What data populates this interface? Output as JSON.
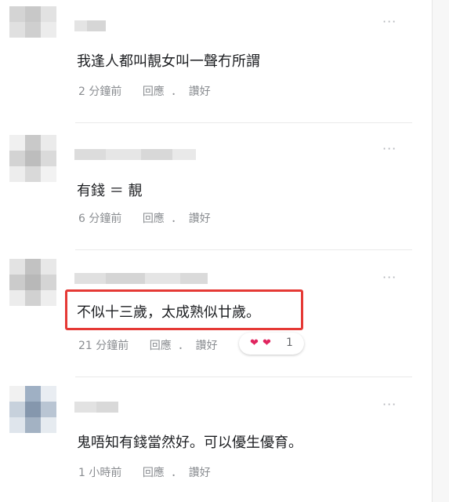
{
  "colors": {
    "text": "#1c1e21",
    "meta": "#8a8d91",
    "highlight_border": "#e53935",
    "love": "#e0245e",
    "separator": "#e9e9e9"
  },
  "icons": {
    "more": "more-dots-icon",
    "love": "heart-icon"
  },
  "comments": [
    {
      "text": "我逢人都叫靚女叫一聲冇所謂",
      "time": "2 分鐘前",
      "reply": "回應",
      "sep": "．",
      "like": "讚好"
    },
    {
      "text": "有錢 ＝ 靚",
      "time": "6 分鐘前",
      "reply": "回應",
      "sep": "．",
      "like": "讚好"
    },
    {
      "text": "不似十三歲，太成熟似廿歲。",
      "time": "21 分鐘前",
      "reply": "回應",
      "sep": "．",
      "like": "讚好",
      "reaction_count": "1"
    },
    {
      "text": "鬼唔知有錢當然好。可以優生優育。",
      "time": "1 小時前",
      "reply": "回應",
      "sep": "．",
      "like": "讚好"
    }
  ],
  "more_glyph": "···",
  "heart_glyph": "❤"
}
